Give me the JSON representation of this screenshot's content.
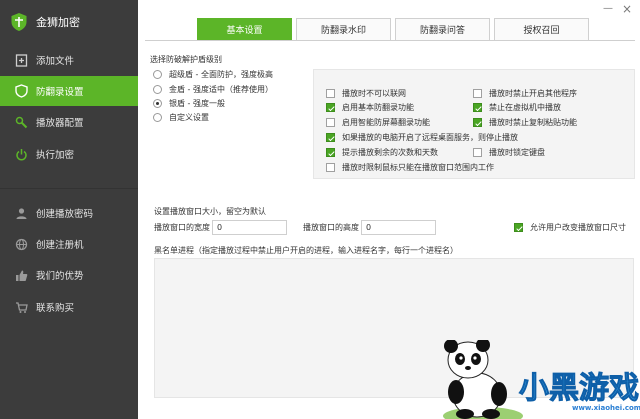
{
  "app": {
    "name": "金狮加密"
  },
  "sidebar": {
    "items": [
      {
        "label": "添加文件",
        "icon": "add-file-icon"
      },
      {
        "label": "防翻录设置",
        "icon": "shield-icon",
        "active": true
      },
      {
        "label": "播放器配置",
        "icon": "wrench-icon"
      },
      {
        "label": "执行加密",
        "icon": "power-icon"
      },
      {
        "label": "创建播放密码",
        "icon": "user-icon"
      },
      {
        "label": "创建注册机",
        "icon": "globe-icon"
      },
      {
        "label": "我们的优势",
        "icon": "thumbs-up-icon"
      },
      {
        "label": "联系购买",
        "icon": "cart-icon"
      }
    ]
  },
  "window": {
    "minimize": "—",
    "close": "×"
  },
  "tabs": [
    {
      "label": "基本设置",
      "active": true
    },
    {
      "label": "防翻录水印"
    },
    {
      "label": "防翻录问答"
    },
    {
      "label": "授权召回"
    }
  ],
  "protection": {
    "title": "选择防破解护盾级别",
    "levels": [
      {
        "label": "超级盾 - 全面防护，强度极高",
        "selected": false
      },
      {
        "label": "金盾 - 强度适中（推荐使用）",
        "selected": false
      },
      {
        "label": "银盾 - 强度一般",
        "selected": true
      },
      {
        "label": "自定义设置",
        "selected": false
      }
    ]
  },
  "options": [
    {
      "label": "播放时不可以联网",
      "checked": false
    },
    {
      "label": "播放时禁止开启其他程序",
      "checked": false
    },
    {
      "label": "启用基本防翻录功能",
      "checked": true
    },
    {
      "label": "禁止在虚拟机中播放",
      "checked": true
    },
    {
      "label": "启用智能防屏幕翻录功能",
      "checked": false
    },
    {
      "label": "播放时禁止复制粘贴功能",
      "checked": true
    },
    {
      "label": "如果播放的电脑开启了远程桌面服务，则停止播放",
      "checked": true
    },
    {
      "label": "提示播放剩余的次数和天数",
      "checked": true
    },
    {
      "label": "播放时锁定键盘",
      "checked": false
    },
    {
      "label": "播放时限制鼠标只能在播放窗口范围内工作",
      "checked": false
    }
  ],
  "window_size": {
    "title": "设置播放窗口大小，留空为默认",
    "width_label": "播放窗口的宽度",
    "width_value": "0",
    "height_label": "播放窗口的高度",
    "height_value": "0",
    "allow_resize_label": "允许用户改变播放窗口尺寸",
    "allow_resize_checked": true
  },
  "blacklist": {
    "title": "黑名单进程（指定播放过程中禁止用户开启的进程，输入进程名字，每行一个进程名）",
    "value": ""
  },
  "watermark": {
    "text": "小黑游戏",
    "url": "www.xiaohei.com"
  },
  "colors": {
    "accent": "#5cb528",
    "sidebar": "#3c3c3c"
  }
}
